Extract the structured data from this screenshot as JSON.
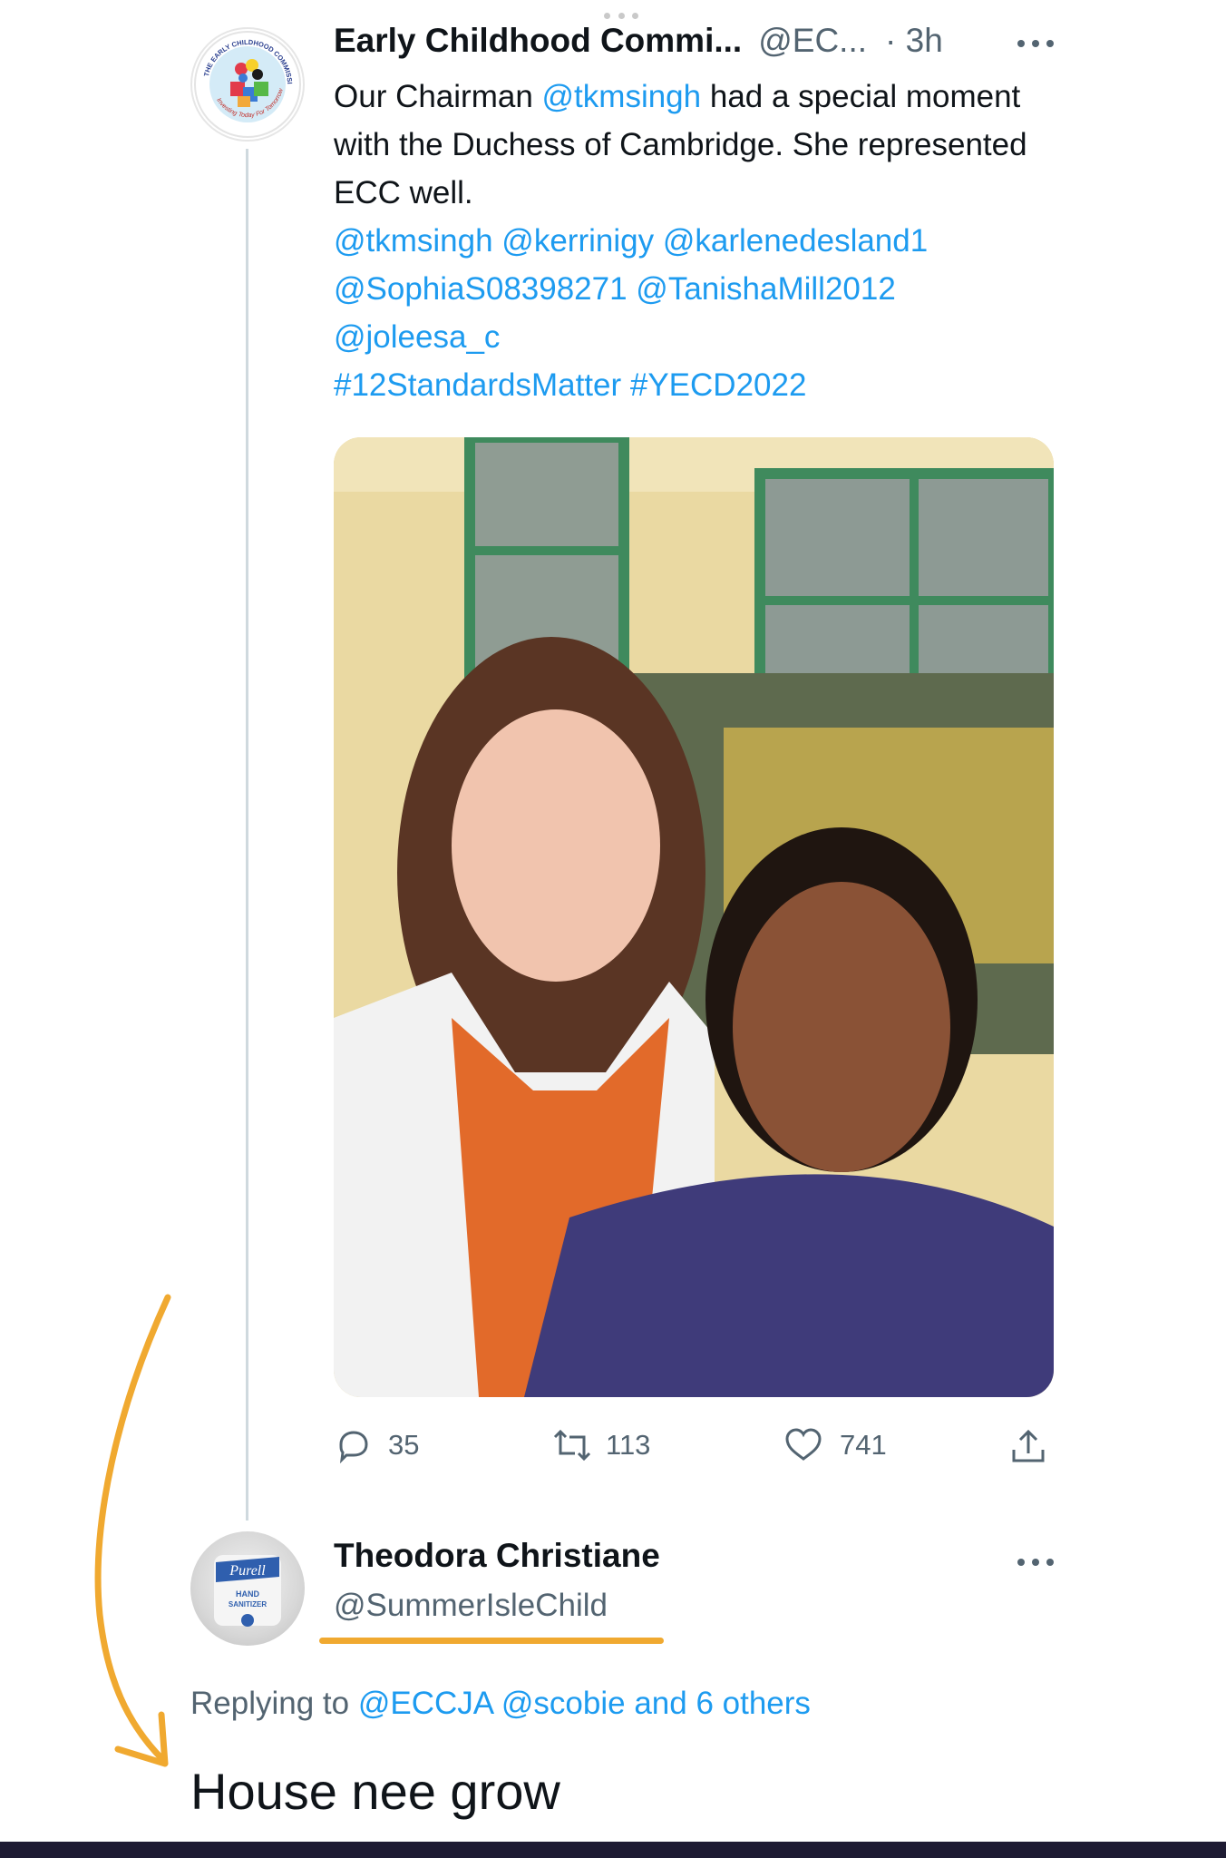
{
  "tweet": {
    "author_name": "Early Childhood Commi...",
    "author_handle": "@EC...",
    "time": "· 3h",
    "avatar_text": [
      "THE EARLY CHILDHOOD COMMISSION",
      "Investing Today For Tomorrow"
    ],
    "text_before": "Our Chairman ",
    "text_mention": "@tkmsingh",
    "text_after": " had a special moment with the Duchess of Cambridge. She represented ECC well.",
    "link_lines": [
      "@tkmsingh @kerrinigy @karlenedesland1",
      "@SophiaS08398271 @TanishaMill2012",
      "@joleesa_c",
      "#12StandardsMatter #YECD2022"
    ],
    "counts": {
      "replies": "35",
      "retweets": "113",
      "likes": "741"
    }
  },
  "reply": {
    "author_name": "Theodora Christiane",
    "author_handle": "@SummerIsleChild",
    "avatar_text": [
      "Purell",
      "HAND",
      "SANITIZER"
    ],
    "replying_prefix": "Replying to ",
    "replying_mentions": "@ECCJA @scobie and 6 others",
    "body": "House nee grow"
  },
  "colors": {
    "link": "#1d9bf0",
    "muted": "#536471",
    "annotation": "#f0a930",
    "thread_line": "#cfd9de"
  },
  "icons": [
    "reply-icon",
    "retweet-icon",
    "like-icon",
    "share-icon",
    "more-icon"
  ]
}
